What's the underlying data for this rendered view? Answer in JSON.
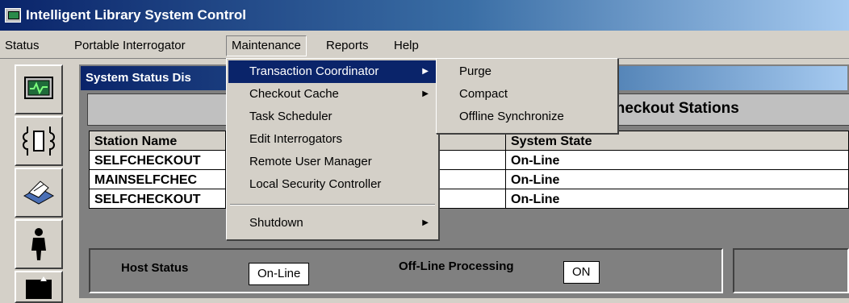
{
  "window": {
    "title": "Intelligent Library System Control"
  },
  "menubar": [
    {
      "label": "Status"
    },
    {
      "label": "Portable Interrogator"
    },
    {
      "label": "Maintenance"
    },
    {
      "label": "Reports"
    },
    {
      "label": "Help"
    }
  ],
  "toolbar": {
    "icons": [
      "monitor-icon",
      "interrogator-icon",
      "printer-icon",
      "person-icon",
      "exit-icon"
    ]
  },
  "panel": {
    "title": "System Status Dis",
    "section_label": "Checkout Stations",
    "columns": [
      "Station Name",
      "System State"
    ],
    "rows": [
      {
        "name": "SELFCHECKOUT",
        "state": "On-Line"
      },
      {
        "name": "MAINSELFCHEC",
        "state": "On-Line"
      },
      {
        "name": "SELFCHECKOUT",
        "state": "On-Line"
      }
    ]
  },
  "status": {
    "host_label": "Host Status",
    "host_value": "On-Line",
    "offline_label": "Off-Line Processing",
    "offline_value": "ON"
  },
  "maintenance_menu": {
    "items": [
      {
        "label": "Transaction Coordinator"
      },
      {
        "label": "Checkout Cache"
      },
      {
        "label": "Task Scheduler"
      },
      {
        "label": "Edit Interrogators"
      },
      {
        "label": "Remote User Manager"
      },
      {
        "label": "Local Security Controller"
      },
      {
        "label": "Shutdown"
      }
    ]
  },
  "submenu": {
    "items": [
      {
        "label": "Purge"
      },
      {
        "label": "Compact"
      },
      {
        "label": "Offline Synchronize"
      }
    ]
  }
}
